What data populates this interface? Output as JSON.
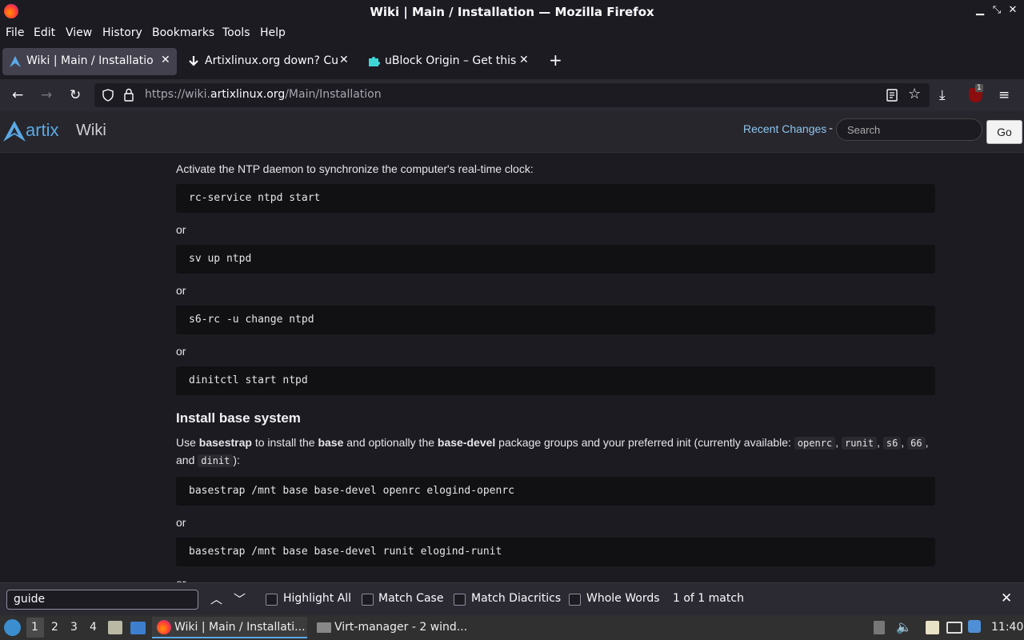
{
  "window": {
    "title": "Wiki | Main / Installation — Mozilla Firefox"
  },
  "menubar": [
    "File",
    "Edit",
    "View",
    "History",
    "Bookmarks",
    "Tools",
    "Help"
  ],
  "tabs": [
    {
      "title": "Wiki | Main / Installation"
    },
    {
      "title": "Artixlinux.org down? Cur"
    },
    {
      "title": "uBlock Origin – Get this E"
    }
  ],
  "navbar": {
    "url_prefix": "https://wiki.",
    "url_domain": "artixlinux.org",
    "url_path": "/Main/Installation",
    "ublock_badge": "1"
  },
  "wiki_header": {
    "logo_text": "artix",
    "logo_wiki": "Wiki",
    "recent_changes": "Recent Changes",
    "separator": "-",
    "search_placeholder": "Search",
    "go_label": "Go"
  },
  "content": {
    "ntp_intro": "Activate the NTP daemon to synchronize the computer's real-time clock:",
    "ntp_commands": [
      "rc-service ntpd start",
      "sv up ntpd",
      "s6-rc -u change ntpd",
      "dinitctl start ntpd"
    ],
    "or": "or",
    "section_title": "Install base system",
    "install_text": {
      "p1": "Use ",
      "basestrap": "basestrap",
      "p2": " to install the ",
      "base": "base",
      "p3": " and optionally the ",
      "base_devel": "base-devel",
      "p4": " package groups and your preferred init (currently available: ",
      "init_openrc": "openrc",
      "init_runit": "runit",
      "init_s6": "s6",
      "init_66": "66",
      "comma": ",",
      "p5": "and ",
      "init_dinit": "dinit",
      "p6": "):"
    },
    "install_commands": [
      "basestrap /mnt base base-devel openrc elogind-openrc",
      "basestrap /mnt base base-devel runit elogind-runit"
    ],
    "trailing_or": "or"
  },
  "findbar": {
    "query": "guide",
    "highlight_all": "Highlight All",
    "match_case": "Match Case",
    "match_diacritics": "Match Diacritics",
    "whole_words": "Whole Words",
    "status": "1 of 1 match"
  },
  "taskbar": {
    "workspaces": [
      "1",
      "2",
      "3",
      "4"
    ],
    "active_workspace": "1",
    "windows": [
      "Wiki | Main / Installati...",
      "Virt-manager - 2 wind..."
    ],
    "clock": "11:40"
  }
}
